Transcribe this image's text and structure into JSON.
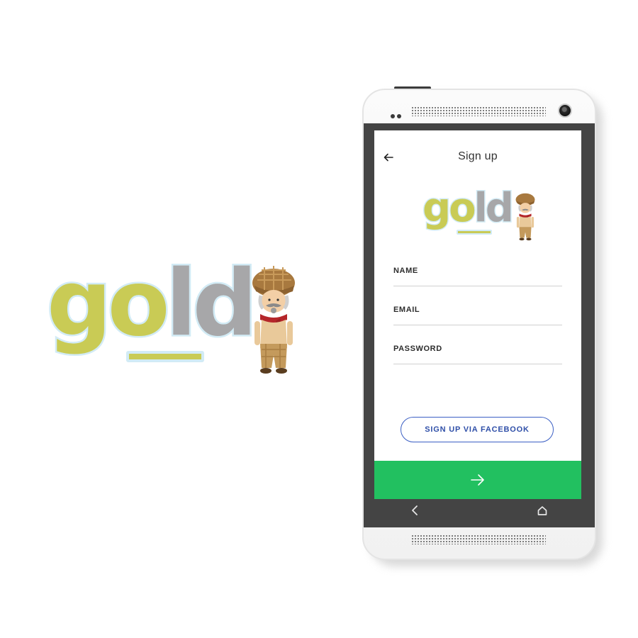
{
  "brand": {
    "logo_text_green": "go",
    "logo_text_grey": "ld",
    "colors": {
      "logo_green": "#c9cb55",
      "logo_grey": "#a7a7a9",
      "logo_outline": "#d2ebf5",
      "accent_green": "#22c060",
      "facebook_blue": "#3b5fc4"
    }
  },
  "header": {
    "back_icon": "arrow-left-icon",
    "title": "Sign up"
  },
  "form": {
    "name_label": "NAME",
    "email_label": "EMAIL",
    "password_label": "PASSWORD"
  },
  "actions": {
    "facebook_label": "SIGN UP VIA FACEBOOK",
    "next_icon": "arrow-right-icon"
  },
  "system_nav": {
    "back_icon": "chevron-left-icon",
    "home_icon": "home-icon"
  }
}
